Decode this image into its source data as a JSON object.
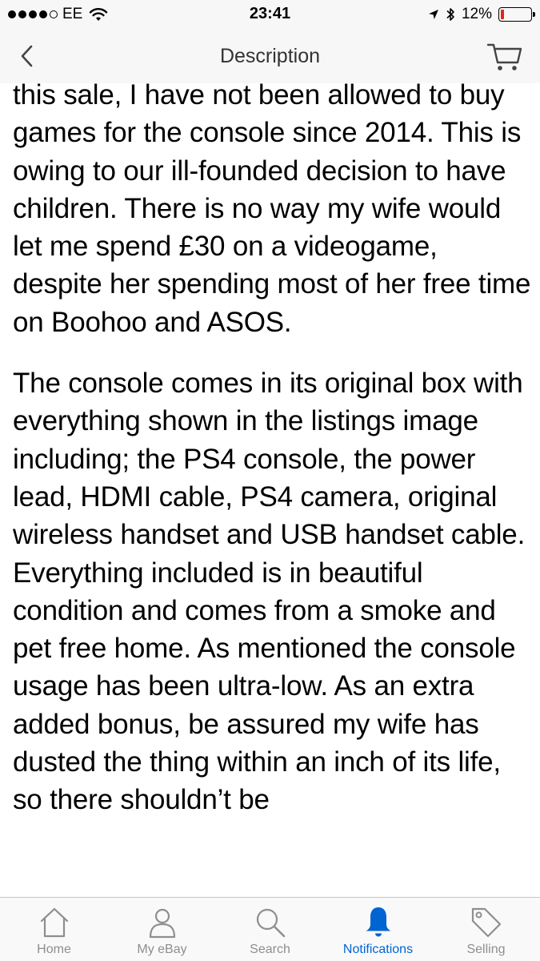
{
  "status_bar": {
    "carrier": "EE",
    "time": "23:41",
    "battery_percent": "12%",
    "battery_level": 0.12,
    "signal_bars_filled": 4,
    "icons": [
      "signal-dots-icon",
      "wifi-icon",
      "location-arrow-icon",
      "bluetooth-icon",
      "battery-icon"
    ]
  },
  "nav": {
    "title": "Description",
    "back_icon": "chevron-left-icon",
    "cart_icon": "cart-icon"
  },
  "description": {
    "paragraphs": [
      "this sale, I have not been allowed to buy games for the console since 2014. This is owing to our ill-founded decision to have children. There is no way my wife would let me spend £30 on a videogame, despite her spending most of her free time on Boohoo and ASOS.",
      "The console comes in its original box with everything shown in the listings image including; the PS4 console, the power lead, HDMI cable, PS4 camera, original wireless handset and USB handset cable. Everything included is in beautiful condition and comes from a smoke and pet free home. As mentioned the console usage has been ultra-low. As an extra added bonus, be assured my wife has dusted the thing within an inch of its life, so there shouldn’t be"
    ]
  },
  "tabs": [
    {
      "label": "Home",
      "icon": "home-icon",
      "active": false
    },
    {
      "label": "My eBay",
      "icon": "person-icon",
      "active": false
    },
    {
      "label": "Search",
      "icon": "search-icon",
      "active": false
    },
    {
      "label": "Notifications",
      "icon": "bell-icon",
      "active": true
    },
    {
      "label": "Selling",
      "icon": "tag-icon",
      "active": false
    }
  ],
  "colors": {
    "accent": "#0064d2",
    "tab_inactive": "#8e8e93",
    "battery_low": "#e0261b",
    "bar_background": "#f7f7f7"
  }
}
